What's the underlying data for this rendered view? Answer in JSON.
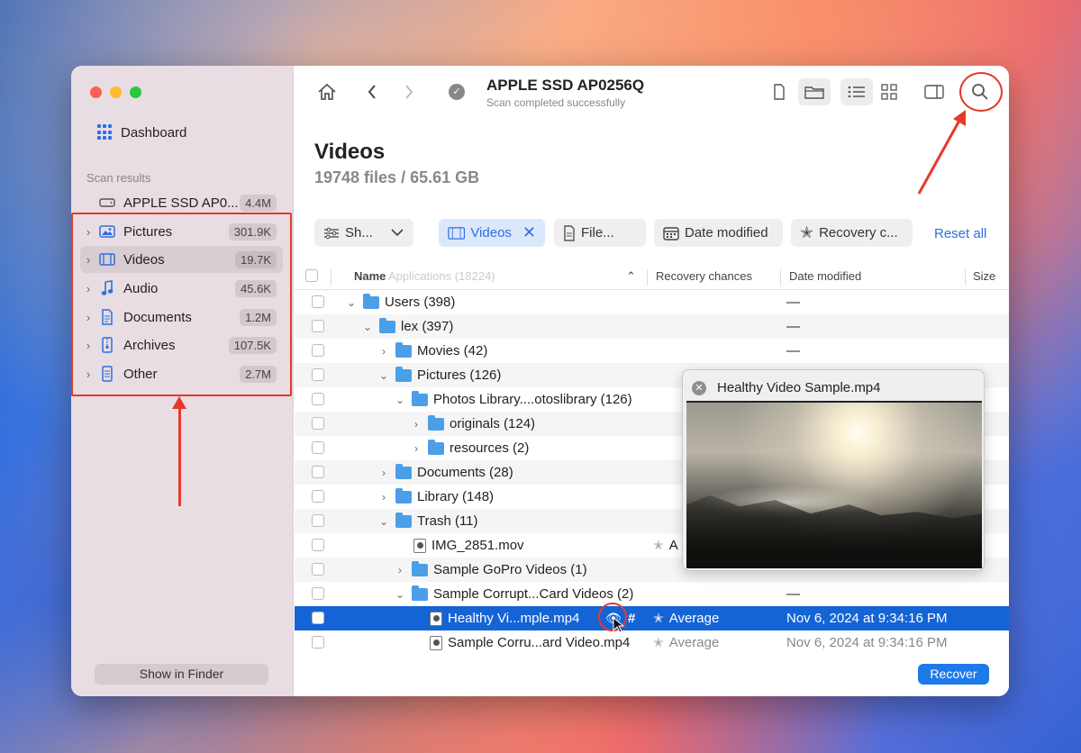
{
  "sidebar": {
    "dashboard_label": "Dashboard",
    "scan_results_label": "Scan results",
    "drive": {
      "label": "APPLE SSD AP0...",
      "count": "4.4M"
    },
    "items": [
      {
        "label": "Pictures",
        "count": "301.9K",
        "icon": "image-icon"
      },
      {
        "label": "Videos",
        "count": "19.7K",
        "icon": "film-icon"
      },
      {
        "label": "Audio",
        "count": "45.6K",
        "icon": "music-note-icon"
      },
      {
        "label": "Documents",
        "count": "1.2M",
        "icon": "document-icon"
      },
      {
        "label": "Archives",
        "count": "107.5K",
        "icon": "archive-icon"
      },
      {
        "label": "Other",
        "count": "2.7M",
        "icon": "file-icon"
      }
    ],
    "show_in_finder": "Show in Finder"
  },
  "toolbar": {
    "drive_name": "APPLE SSD AP0256Q",
    "status": "Scan completed successfully"
  },
  "page": {
    "title": "Videos",
    "subtitle": "19748 files / 65.61 GB"
  },
  "filters": {
    "show": "Sh...",
    "videos": "Videos",
    "file": "File...",
    "date_modified": "Date modified",
    "recovery": "Recovery c...",
    "reset_all": "Reset all"
  },
  "table": {
    "headers": {
      "name": "Name",
      "ghost": "Applications (18224)",
      "recovery": "Recovery chances",
      "date": "Date modified",
      "size": "Size"
    },
    "rows": [
      {
        "name": "Users (398)",
        "date": "—"
      },
      {
        "name": "lex (397)",
        "date": "—"
      },
      {
        "name": "Movies (42)",
        "date": "—"
      },
      {
        "name": "Pictures (126)"
      },
      {
        "name": "Photos Library....otoslibrary (126)"
      },
      {
        "name": "originals (124)"
      },
      {
        "name": "resources (2)"
      },
      {
        "name": "Documents (28)"
      },
      {
        "name": "Library (148)"
      },
      {
        "name": "Trash (11)"
      },
      {
        "name": "IMG_2851.mov",
        "recovery": "A"
      },
      {
        "name": "Sample GoPro Videos (1)"
      },
      {
        "name": "Sample Corrupt...Card Videos (2)",
        "date": "—"
      },
      {
        "name": "Healthy Vi...mple.mp4",
        "recovery": "Average",
        "date": "Nov 6, 2024 at 9:34:16 PM"
      },
      {
        "name": "Sample Corru...ard Video.mp4",
        "recovery": "Average",
        "date": "Nov 6, 2024 at 9:34:16 PM"
      }
    ]
  },
  "preview": {
    "title": "Healthy Video Sample.mp4"
  },
  "footer": {
    "recover": "Recover"
  },
  "colors": {
    "accent": "#1464d6",
    "annotation": "#e5392b"
  }
}
